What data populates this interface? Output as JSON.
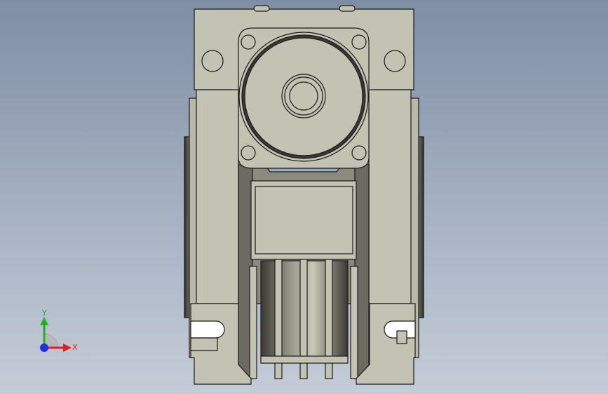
{
  "viewport": {
    "background_top": "#7f8ea5",
    "background_bottom": "#c5ccd8"
  },
  "model": {
    "body_color": "#c3c3b3",
    "dark_color": "#5a5a52",
    "edge_color": "#1a1a1a"
  },
  "triad": {
    "x_label": "X",
    "y_label": "Y",
    "x_color": "#e02020",
    "y_color": "#20b020",
    "z_color": "#2030e0"
  }
}
